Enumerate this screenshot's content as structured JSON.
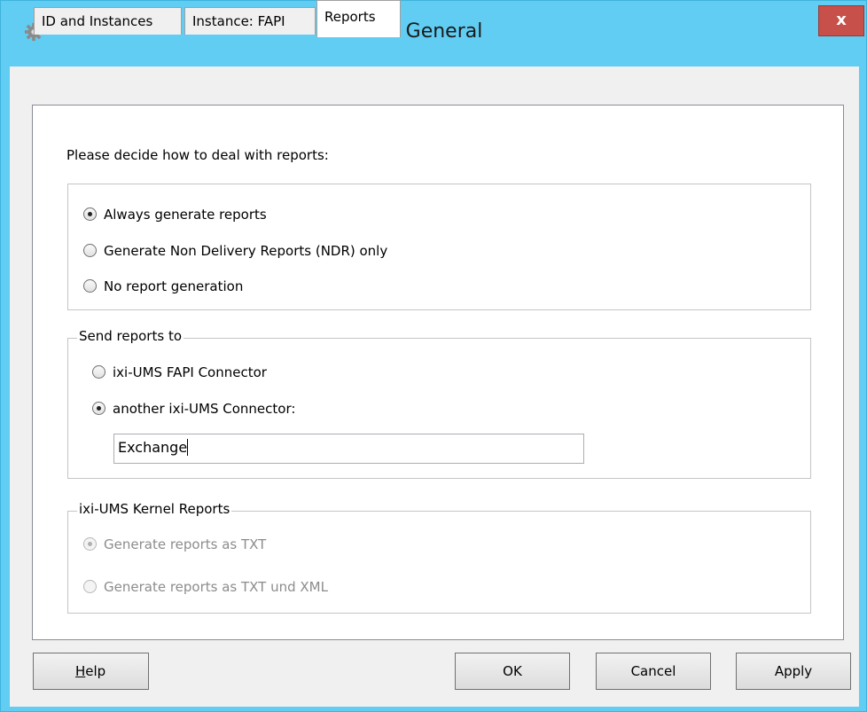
{
  "window": {
    "title": "General",
    "close_label": "x",
    "title_icon": "gear-icon"
  },
  "tabs": [
    {
      "label": "ID and Instances",
      "active": false
    },
    {
      "label": "Instance: FAPI",
      "active": false
    },
    {
      "label": "Reports",
      "active": true
    }
  ],
  "reports": {
    "prompt": "Please decide how to deal with reports:",
    "options": [
      {
        "label": "Always generate reports",
        "checked": true
      },
      {
        "label": "Generate Non Delivery Reports (NDR) only",
        "checked": false
      },
      {
        "label": "No report generation",
        "checked": false
      }
    ]
  },
  "send_reports": {
    "legend": "Send reports to",
    "options": [
      {
        "label": "ixi-UMS FAPI Connector",
        "checked": false
      },
      {
        "label": "another ixi-UMS Connector:",
        "checked": true
      }
    ],
    "connector_value": "Exchange"
  },
  "kernel_reports": {
    "legend": "ixi-UMS Kernel Reports",
    "options": [
      {
        "label": "Generate reports as TXT",
        "checked": true,
        "disabled": true
      },
      {
        "label": "Generate reports as TXT und XML",
        "checked": false,
        "disabled": true
      }
    ]
  },
  "buttons": {
    "help_mnemonic": "H",
    "help_rest": "elp",
    "ok": "OK",
    "cancel": "Cancel",
    "apply": "Apply"
  },
  "colors": {
    "title_bar": "#61cdf3",
    "close_button": "#c7504a"
  }
}
